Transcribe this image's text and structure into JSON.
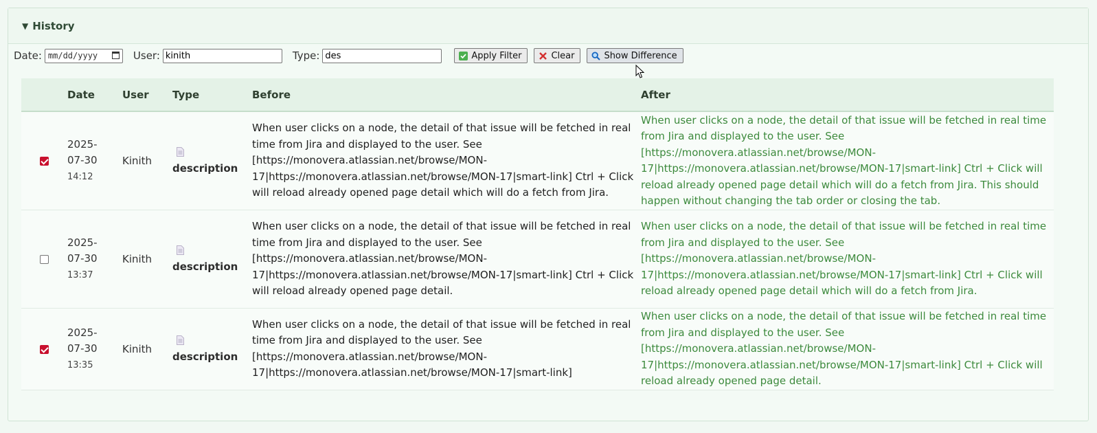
{
  "panel": {
    "title": "History"
  },
  "filter": {
    "date_label": "Date:",
    "date_placeholder": "mm/dd/yyyy",
    "user_label": "User:",
    "user_value": "kinith",
    "type_label": "Type:",
    "type_value": "des",
    "apply_label": "Apply Filter",
    "clear_label": "Clear",
    "diff_label": "Show Difference"
  },
  "table": {
    "headers": [
      "",
      "Date",
      "User",
      "Type",
      "Before",
      "After"
    ],
    "rows": [
      {
        "checked": true,
        "date": "2025-07-30",
        "date_line1": "2025-",
        "date_line2": "07-30",
        "time": "14:12",
        "user": "Kinith",
        "type": "description",
        "before": "When user clicks on a node, the detail of that issue will be fetched in real time from Jira and displayed to the user. See [https://monovera.atlassian.net/browse/MON-17|https://monovera.atlassian.net/browse/MON-17|smart-link] Ctrl + Click will reload already opened page detail which will do a fetch from Jira.",
        "after": "When user clicks on a node, the detail of that issue will be fetched in real time from Jira and displayed to the user. See [https://monovera.atlassian.net/browse/MON-17|https://monovera.atlassian.net/browse/MON-17|smart-link] Ctrl + Click will reload already opened page detail which will do a fetch from Jira. This should happen without changing the tab order or closing the tab."
      },
      {
        "checked": false,
        "date": "2025-07-30",
        "date_line1": "2025-",
        "date_line2": "07-30",
        "time": "13:37",
        "user": "Kinith",
        "type": "description",
        "before": "When user clicks on a node, the detail of that issue will be fetched in real time from Jira and displayed to the user. See [https://monovera.atlassian.net/browse/MON-17|https://monovera.atlassian.net/browse/MON-17|smart-link] Ctrl + Click will reload already opened page detail.",
        "after": "When user clicks on a node, the detail of that issue will be fetched in real time from Jira and displayed to the user. See [https://monovera.atlassian.net/browse/MON-17|https://monovera.atlassian.net/browse/MON-17|smart-link] Ctrl + Click will reload already opened page detail which will do a fetch from Jira."
      },
      {
        "checked": true,
        "date": "2025-07-30",
        "date_line1": "2025-",
        "date_line2": "07-30",
        "time": "13:35",
        "user": "Kinith",
        "type": "description",
        "before": "When user clicks on a node, the detail of that issue will be fetched in real time from Jira and displayed to the user. See [https://monovera.atlassian.net/browse/MON-17|https://monovera.atlassian.net/browse/MON-17|smart-link]",
        "after": "When user clicks on a node, the detail of that issue will be fetched in real time from Jira and displayed to the user. See [https://monovera.atlassian.net/browse/MON-17|https://monovera.atlassian.net/browse/MON-17|smart-link] Ctrl + Click will reload already opened page detail."
      }
    ]
  },
  "icons": {
    "collapse": "caret-down-icon",
    "apply": "check-icon",
    "clear": "x-icon",
    "diff": "magnifier-icon",
    "type": "document-icon",
    "calendar": "calendar-icon"
  },
  "colors": {
    "after_text": "#3d8a3d",
    "checkbox_checked": "#c8102e",
    "panel_bg": "#f3faf5"
  }
}
